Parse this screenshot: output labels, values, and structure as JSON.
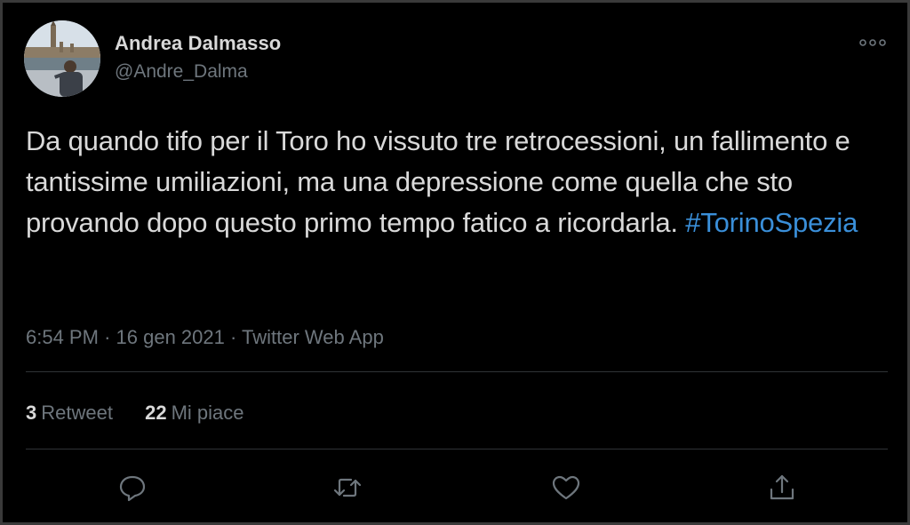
{
  "tweet": {
    "author": {
      "display_name": "Andrea Dalmasso",
      "handle": "@Andre_Dalma"
    },
    "text": "Da quando tifo per il Toro ho vissuto tre retrocessioni, un fallimento e tantissime umiliazioni, ma una depressione come quella che sto provando dopo questo primo tempo fatico a ricordarla.",
    "hashtag": "#TorinoSpezia",
    "time": "6:54 PM",
    "date": "16 gen 2021",
    "source": "Twitter Web App",
    "separator": "·"
  },
  "stats": {
    "retweets_count": "3",
    "retweets_label": "Retweet",
    "likes_count": "22",
    "likes_label": "Mi piace"
  },
  "icons": {
    "more": "more-options-icon",
    "reply": "reply-icon",
    "retweet": "retweet-icon",
    "like": "like-icon",
    "share": "share-icon"
  },
  "colors": {
    "background": "#000000",
    "text": "#d9d9d9",
    "secondary": "#6e767d",
    "link": "#3a8fd9",
    "divider": "#2f3336"
  }
}
